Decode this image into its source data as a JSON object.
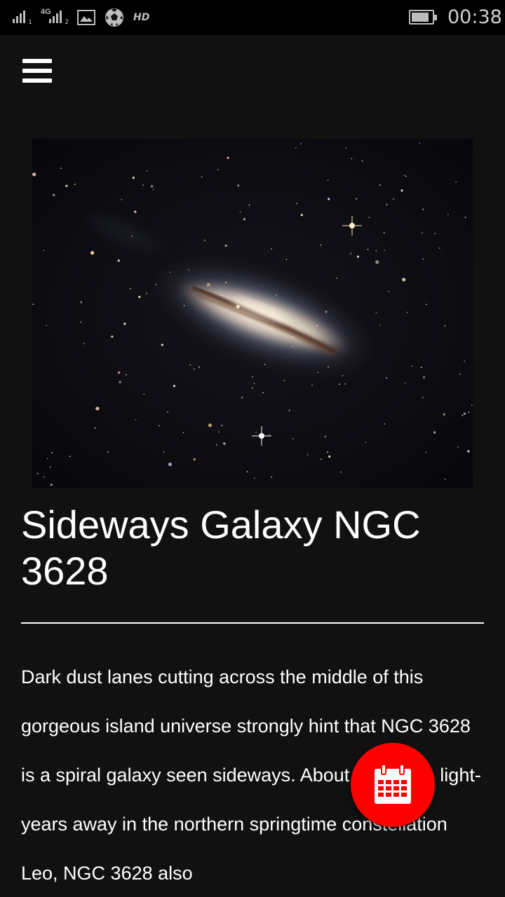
{
  "status_bar": {
    "sim1_index": "1",
    "network_type": "4G",
    "sim2_index": "2",
    "hd_label": "HD",
    "battery_level": 0.85,
    "time": "00:38"
  },
  "icons": {
    "menu": "hamburger-menu-icon",
    "calendar": "calendar-icon",
    "gallery": "image-icon",
    "ball": "soccer-ball-icon"
  },
  "article": {
    "image_alt": "Sideways Galaxy NGC 3628",
    "title": "Sideways Galaxy NGC 3628",
    "body": "Dark dust lanes cutting across the middle of this gorgeous island universe strongly hint that NGC 3628 is a spiral galaxy seen sideways. About 35 million light-years away in the northern springtime constellation Leo, NGC 3628 also"
  },
  "colors": {
    "background": "#111111",
    "status_bar": "#000000",
    "fab": "#ff0000",
    "text": "#ffffff"
  }
}
